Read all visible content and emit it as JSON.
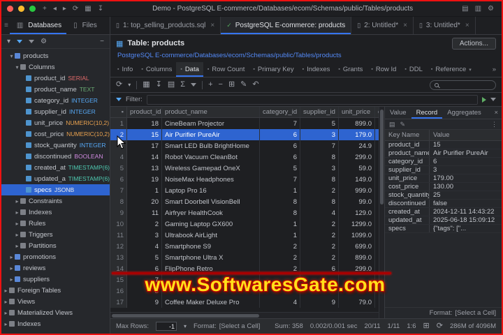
{
  "icons": {
    "plus": "+",
    "minus": "−",
    "refresh": "⟳",
    "undo": "↶",
    "grid": "▦",
    "table": "▤",
    "export": "↧",
    "sigma": "Σ",
    "pencil": "✎",
    "gear": "⚙",
    "check": "✓",
    "close": "×",
    "chevron-down": "▾",
    "chevron-right": "▸",
    "chevron-left": "◂",
    "overflow": "»",
    "dot": "▪",
    "file": "▯",
    "db": "▥",
    "kebab": "⋮",
    "menu": "≡",
    "copy": "⊞"
  },
  "colors": {
    "accent": "#3574f0",
    "selection": "#2e64d0",
    "link": "#548af7",
    "watermark_fill": "#ffe11a",
    "watermark_outline": "#c40000",
    "frame_border": "#ee1111"
  },
  "titlebar": {
    "title": "Demo - PostgreSQL E-commerce/Databases/ecom/Schemas/public/Tables/products"
  },
  "nav": {
    "databases": "Databases",
    "files": "Files"
  },
  "editor_tabs": [
    {
      "label": "1: top_selling_products.sql",
      "icon": "file",
      "close": true
    },
    {
      "label": "PostgreSQL E-commerce: products",
      "icon": "check",
      "active": true,
      "close": false
    },
    {
      "label": "2: Untitled*",
      "icon": "file",
      "close": true
    },
    {
      "label": "3: Untitled*",
      "icon": "file",
      "close": true
    }
  ],
  "type_colors": {
    "SERIAL": "#e06a6a",
    "TEXT": "#6aab73",
    "INTEGER": "#56a8f5",
    "NUMERIC(10,2)": "#e8a14f",
    "BOOLEAN": "#d08ae0",
    "TIMESTAMP(6)": "#4ec9b0",
    "JSONB": "#eaeaea"
  },
  "sidebar": {
    "tree": [
      {
        "label": "products",
        "depth": 1,
        "state": "expanded",
        "icon": "table"
      },
      {
        "label": "Columns",
        "depth": 2,
        "state": "expanded",
        "icon": "folder"
      },
      {
        "label": "product_id",
        "type": "SERIAL",
        "depth": 3,
        "state": "leaf",
        "icon": "column"
      },
      {
        "label": "product_name",
        "type": "TEXT",
        "depth": 3,
        "state": "leaf",
        "icon": "column"
      },
      {
        "label": "category_id",
        "type": "INTEGER",
        "depth": 3,
        "state": "leaf",
        "icon": "column"
      },
      {
        "label": "supplier_id",
        "type": "INTEGER",
        "depth": 3,
        "state": "leaf",
        "icon": "column"
      },
      {
        "label": "unit_price",
        "type": "NUMERIC(10,2)",
        "depth": 3,
        "state": "leaf",
        "icon": "column"
      },
      {
        "label": "cost_price",
        "type": "NUMERIC(10,2)",
        "depth": 3,
        "state": "leaf",
        "icon": "column"
      },
      {
        "label": "stock_quantity",
        "type": "INTEGER",
        "depth": 3,
        "state": "leaf",
        "icon": "column"
      },
      {
        "label": "discontinued",
        "type": "BOOLEAN",
        "depth": 3,
        "state": "leaf",
        "icon": "column"
      },
      {
        "label": "created_at",
        "type": "TIMESTAMP(6)",
        "depth": 3,
        "state": "leaf",
        "icon": "column"
      },
      {
        "label": "updated_at",
        "type": "TIMESTAMP(6)",
        "depth": 3,
        "state": "leaf",
        "icon": "column"
      },
      {
        "label": "specs",
        "type": "JSONB",
        "depth": 3,
        "state": "leaf",
        "icon": "column",
        "selected": true
      },
      {
        "label": "Constraints",
        "depth": 2,
        "state": "collapsed",
        "icon": "folder"
      },
      {
        "label": "Indexes",
        "depth": 2,
        "state": "collapsed",
        "icon": "folder"
      },
      {
        "label": "Rules",
        "depth": 2,
        "state": "collapsed",
        "icon": "folder"
      },
      {
        "label": "Triggers",
        "depth": 2,
        "state": "collapsed",
        "icon": "folder"
      },
      {
        "label": "Partitions",
        "depth": 2,
        "state": "collapsed",
        "icon": "folder"
      },
      {
        "label": "promotions",
        "depth": 1,
        "state": "collapsed",
        "icon": "table"
      },
      {
        "label": "reviews",
        "depth": 1,
        "state": "collapsed",
        "icon": "table"
      },
      {
        "label": "suppliers",
        "depth": 1,
        "state": "collapsed",
        "icon": "table"
      },
      {
        "label": "Foreign Tables",
        "depth": 0,
        "state": "collapsed",
        "icon": "folder"
      },
      {
        "label": "Views",
        "depth": 0,
        "state": "collapsed",
        "icon": "folder"
      },
      {
        "label": "Materialized Views",
        "depth": 0,
        "state": "collapsed",
        "icon": "folder"
      },
      {
        "label": "Indexes",
        "depth": 0,
        "state": "collapsed",
        "icon": "folder"
      }
    ]
  },
  "object_view": {
    "title": "Table: products",
    "actions_label": "Actions...",
    "breadcrumb": "PostgreSQL E-commerce/Databases/ecom/Schemas/public/Tables/products",
    "tabs": [
      {
        "label": "Info"
      },
      {
        "label": "Columns"
      },
      {
        "label": "Data",
        "active": true
      },
      {
        "label": "Row Count"
      },
      {
        "label": "Primary Key"
      },
      {
        "label": "Indexes"
      },
      {
        "label": "Grants"
      },
      {
        "label": "Row Id"
      },
      {
        "label": "DDL"
      },
      {
        "label": "Reference",
        "chevron": true
      }
    ],
    "filter_label": "Filter:"
  },
  "grid": {
    "corner": "▪",
    "columns": [
      "product_id",
      "product_name",
      "category_id",
      "supplier_id",
      "unit_price",
      "cost_price"
    ],
    "selected_row": 2,
    "rows": [
      {
        "num": "1",
        "cells": [
          "18",
          "CineBeam Projector",
          "7",
          "5",
          "899.0",
          ""
        ]
      },
      {
        "num": "2",
        "cells": [
          "15",
          "Air Purifier PureAir",
          "6",
          "3",
          "179.0",
          ""
        ]
      },
      {
        "num": "3",
        "cells": [
          "17",
          "Smart LED Bulb BrightHome",
          "6",
          "7",
          "24.9",
          ""
        ]
      },
      {
        "num": "4",
        "cells": [
          "14",
          "Robot Vacuum CleanBot",
          "6",
          "8",
          "299.0",
          ""
        ]
      },
      {
        "num": "5",
        "cells": [
          "13",
          "Wireless Gamepad OneX",
          "5",
          "3",
          "59.0",
          ""
        ]
      },
      {
        "num": "6",
        "cells": [
          "19",
          "NoiseMax Headphones",
          "7",
          "8",
          "149.0",
          ""
        ]
      },
      {
        "num": "7",
        "cells": [
          "1",
          "Laptop Pro 16",
          "1",
          "2",
          "999.0",
          ""
        ]
      },
      {
        "num": "8",
        "cells": [
          "20",
          "Smart Doorbell VisionBell",
          "8",
          "8",
          "99.0",
          ""
        ]
      },
      {
        "num": "9",
        "cells": [
          "11",
          "Airfryer HealthCook",
          "8",
          "4",
          "129.0",
          ""
        ]
      },
      {
        "num": "10",
        "cells": [
          "2",
          "Gaming Laptop GX600",
          "1",
          "2",
          "1299.0",
          ""
        ]
      },
      {
        "num": "11",
        "cells": [
          "3",
          "Ultrabook AirLight",
          "1",
          "2",
          "1099.0",
          ""
        ]
      },
      {
        "num": "12",
        "cells": [
          "4",
          "Smartphone S9",
          "2",
          "2",
          "699.0",
          ""
        ]
      },
      {
        "num": "13",
        "cells": [
          "5",
          "Smartphone Ultra X",
          "2",
          "2",
          "899.0",
          ""
        ]
      },
      {
        "num": "14",
        "cells": [
          "6",
          "FlipPhone Retro",
          "2",
          "6",
          "299.0",
          ""
        ]
      },
      {
        "num": "15",
        "cells": [
          "7",
          "",
          "",
          "",
          "",
          ""
        ]
      },
      {
        "num": "16",
        "cells": [
          "8",
          "",
          "",
          "",
          "",
          ""
        ]
      },
      {
        "num": "17",
        "cells": [
          "9",
          "Coffee Maker Deluxe Pro",
          "4",
          "9",
          "79.0",
          ""
        ]
      }
    ]
  },
  "record_panel": {
    "tabs": [
      {
        "label": "Value"
      },
      {
        "label": "Record",
        "active": true
      },
      {
        "label": "Aggregates"
      }
    ],
    "header_key": "Key Name",
    "header_value": "Value",
    "fields": [
      {
        "key": "product_id",
        "value": "15"
      },
      {
        "key": "product_name",
        "value": "Air Purifier PureAir"
      },
      {
        "key": "category_id",
        "value": "6"
      },
      {
        "key": "supplier_id",
        "value": "3"
      },
      {
        "key": "unit_price",
        "value": "179.00"
      },
      {
        "key": "cost_price",
        "value": "130.00"
      },
      {
        "key": "stock_quantity",
        "value": "25"
      },
      {
        "key": "discontinued",
        "value": "false"
      },
      {
        "key": "created_at",
        "value": "2024-12-11 14:43:22"
      },
      {
        "key": "updated_at",
        "value": "2025-06-18 15:09:12"
      },
      {
        "key": "specs",
        "value": "{\"tags\": [\"..."
      }
    ],
    "format_label": "Format:",
    "format_value": "[Select a Cell]"
  },
  "status_bar": {
    "max_rows_label": "Max Rows:",
    "max_rows_value": "-1",
    "format_label": "Format:",
    "format_value": "[Select a Cell]",
    "sum": "Sum: 358",
    "exec_time": "0.002/0.001 sec",
    "rows_cols": "20/11",
    "position": "1/11",
    "cell_ref": "1:6",
    "memory": "286M of 4096M"
  },
  "watermark": {
    "text": "www.SoftwaresGate.com"
  }
}
